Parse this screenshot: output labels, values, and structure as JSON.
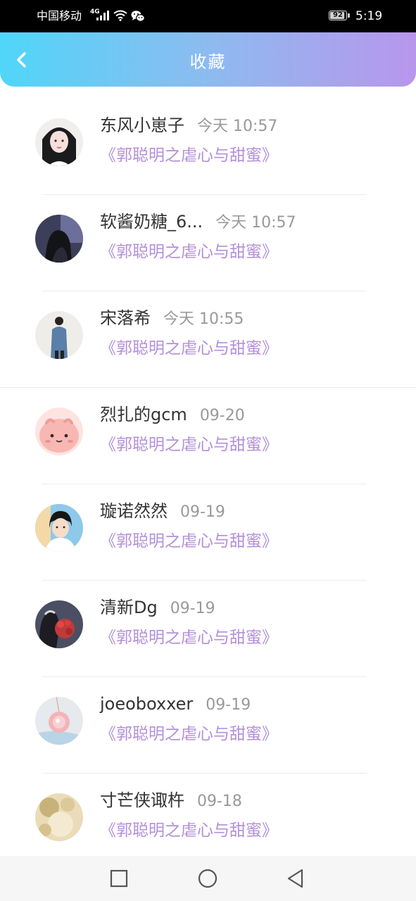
{
  "status_bar": {
    "carrier": "中国移动",
    "network_type": "4G",
    "battery_level": "92",
    "time": "5:19"
  },
  "header": {
    "title": "收藏"
  },
  "colors": {
    "header_gradient": [
      "#4fd6f8",
      "#8dbbf0",
      "#b896ec"
    ],
    "book_title": "#b390d8",
    "user_name": "#333333",
    "time": "#999999"
  },
  "favorites": [
    {
      "user": "东风小崽子",
      "time": "今天 10:57",
      "book": "《郭聪明之虐心与甜蜜》"
    },
    {
      "user": "软酱奶糖_6...",
      "time": "今天 10:57",
      "book": "《郭聪明之虐心与甜蜜》"
    },
    {
      "user": "宋落希",
      "time": "今天 10:55",
      "book": "《郭聪明之虐心与甜蜜》"
    },
    {
      "user": "烈扎的gcm",
      "time": "09-20",
      "book": "《郭聪明之虐心与甜蜜》"
    },
    {
      "user": "璇诺然然",
      "time": "09-19",
      "book": "《郭聪明之虐心与甜蜜》"
    },
    {
      "user": "清新Dg",
      "time": "09-19",
      "book": "《郭聪明之虐心与甜蜜》"
    },
    {
      "user": "joeoboxxer",
      "time": "09-19",
      "book": "《郭聪明之虐心与甜蜜》"
    },
    {
      "user": "寸芒侠诹杵",
      "time": "09-18",
      "book": "《郭聪明之虐心与甜蜜》"
    }
  ],
  "nav_bar": {
    "icons": [
      "recent-apps-icon",
      "home-icon",
      "back-icon"
    ]
  }
}
